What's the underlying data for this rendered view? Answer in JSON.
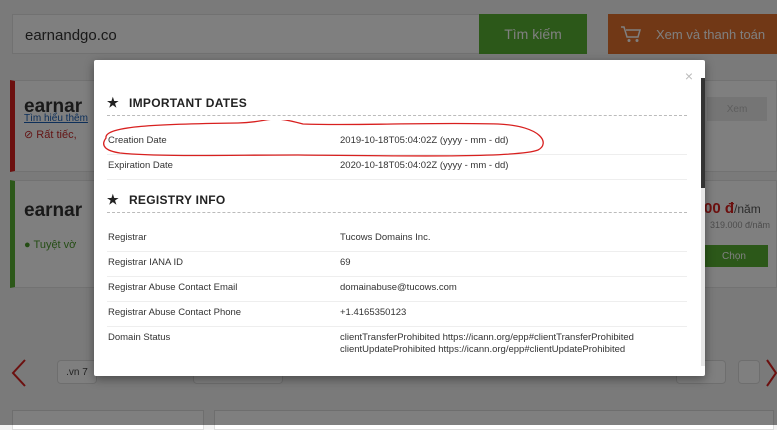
{
  "search": {
    "value": "earnandgo.co",
    "button_label": "Tìm kiếm"
  },
  "cart": {
    "label": "Xem và thanh toán",
    "icon": "cart-icon"
  },
  "cards": [
    {
      "title": "earnar",
      "link": "Tìm hiểu thêm",
      "status": "Rất tiếc,",
      "button": "Xem"
    },
    {
      "title": "earnar",
      "status": "Tuyệt vờ",
      "price": "00 đ",
      "price_unit": "/năm",
      "old_price": "319.000 đ/năm",
      "button": "Chọn"
    }
  ],
  "tld_pills": [
    ".vn 7",
    "",
    "",
    ""
  ],
  "modal": {
    "close": "×",
    "sections": [
      {
        "title": "IMPORTANT DATES",
        "rows": [
          {
            "label": "Creation Date",
            "value": "2019-10-18T05:04:02Z (yyyy - mm - dd)"
          },
          {
            "label": "Expiration Date",
            "value": "2020-10-18T05:04:02Z (yyyy - mm - dd)"
          }
        ]
      },
      {
        "title": "REGISTRY INFO",
        "rows": [
          {
            "label": "Registrar",
            "value": "Tucows Domains Inc."
          },
          {
            "label": "Registrar IANA ID",
            "value": "69"
          },
          {
            "label": "Registrar Abuse Contact Email",
            "value": "domainabuse@tucows.com"
          },
          {
            "label": "Registrar Abuse Contact Phone",
            "value": "+1.4165350123"
          },
          {
            "label": "Domain Status",
            "value": "clientTransferProhibited https://icann.org/epp#clientTransferProhibited",
            "value2": "clientUpdateProhibited https://icann.org/epp#clientUpdateProhibited"
          }
        ]
      }
    ]
  },
  "colors": {
    "accent_green": "#58b132",
    "accent_orange": "#e2702c",
    "alert_red": "#d8201f",
    "annotation_red": "#d8201f"
  }
}
